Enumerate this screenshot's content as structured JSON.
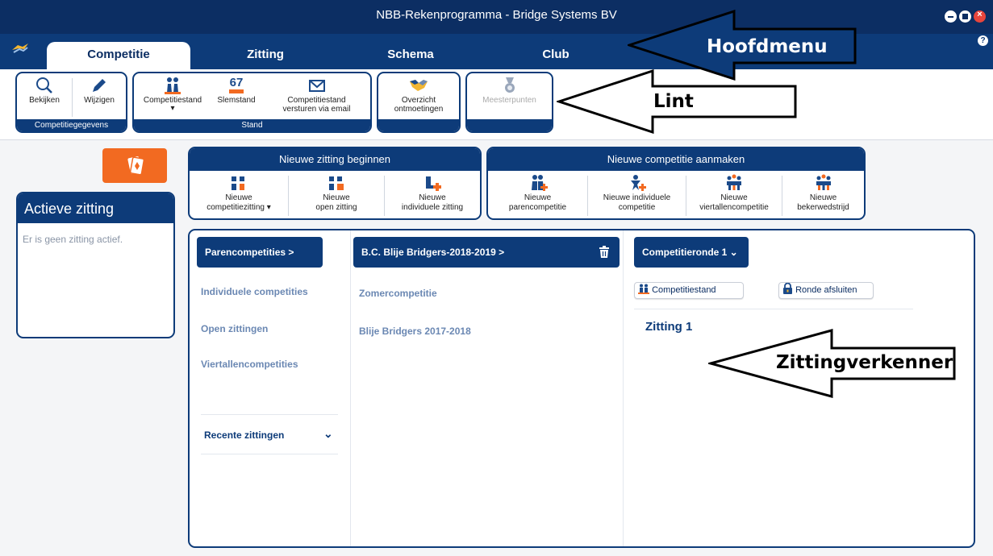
{
  "window": {
    "title": "NBB-Rekenprogramma - Bridge Systems BV"
  },
  "tabs": [
    {
      "label": "Competitie",
      "active": true
    },
    {
      "label": "Zitting",
      "active": false
    },
    {
      "label": "Schema",
      "active": false
    },
    {
      "label": "Club",
      "active": false
    }
  ],
  "help_label": "?",
  "ribbon": {
    "groups": [
      {
        "footer": "Competitiegegevens",
        "buttons": [
          {
            "label": "Bekijken",
            "icon": "magnifier-icon"
          },
          {
            "label": "Wijzigen",
            "icon": "pencil-icon"
          }
        ]
      },
      {
        "footer": "Stand",
        "buttons": [
          {
            "label": "Competitiestand",
            "icon": "players-icon",
            "dropdown": "▾"
          },
          {
            "label": "Slemstand",
            "icon": "slem-67-icon",
            "badge": "67"
          },
          {
            "label": "Competitiestand versturen via email",
            "line1": "Competitiestand",
            "line2": "versturen via email",
            "icon": "envelope-icon"
          }
        ]
      },
      {
        "footer": "",
        "buttons": [
          {
            "label": "Overzicht ontmoetingen",
            "line1": "Overzicht",
            "line2": "ontmoetingen",
            "icon": "handshake-icon"
          }
        ]
      },
      {
        "footer": "",
        "buttons": [
          {
            "label": "Meesterpunten",
            "icon": "medal-icon",
            "disabled": true
          }
        ]
      }
    ]
  },
  "active_session": {
    "title": "Actieve zitting",
    "empty_text": "Er is geen zitting actief."
  },
  "new_session": {
    "title": "Nieuwe zitting beginnen",
    "buttons": [
      {
        "line1": "Nieuwe",
        "line2": "competitiezitting ▾",
        "icon": "competition-session-icon"
      },
      {
        "line1": "Nieuwe",
        "line2": "open zitting",
        "icon": "open-session-icon"
      },
      {
        "line1": "Nieuwe",
        "line2": "individuele zitting",
        "icon": "individual-session-icon"
      }
    ]
  },
  "new_competition": {
    "title": "Nieuwe competitie aanmaken",
    "buttons": [
      {
        "line1": "Nieuwe",
        "line2": "parencompetitie",
        "icon": "pairs-icon"
      },
      {
        "line1": "Nieuwe individuele",
        "line2": "competitie",
        "icon": "individual-icon"
      },
      {
        "line1": "Nieuwe",
        "line2": "viertallencompetitie",
        "icon": "teams-icon"
      },
      {
        "line1": "Nieuwe",
        "line2": "bekerwedstrijd",
        "icon": "cup-icon"
      }
    ]
  },
  "explorer": {
    "col1": {
      "selected": "Parencompetities >",
      "items": [
        "Individuele competities",
        "Open zittingen",
        "Viertallencompetities"
      ],
      "recent": "Recente zittingen",
      "recent_icon": "⌄"
    },
    "col2": {
      "selected": "B.C. Blije Bridgers-2018-2019  >",
      "items": [
        "Zomercompetitie",
        "Blije Bridgers 2017-2018"
      ]
    },
    "col3": {
      "selected": "Competitieronde 1  ⌄",
      "btn_standings": "Competitiestand",
      "btn_close_round": "Ronde afsluiten",
      "session": "Zitting 1"
    }
  },
  "annotations": [
    "Hoofdmenu",
    "Lint",
    "Zittingverkenner"
  ],
  "colors": {
    "navy": "#0c2e63",
    "tab_blue": "#0d3b79",
    "orange": "#f26a21",
    "link": "#6b88b3",
    "close": "#e8453c"
  }
}
